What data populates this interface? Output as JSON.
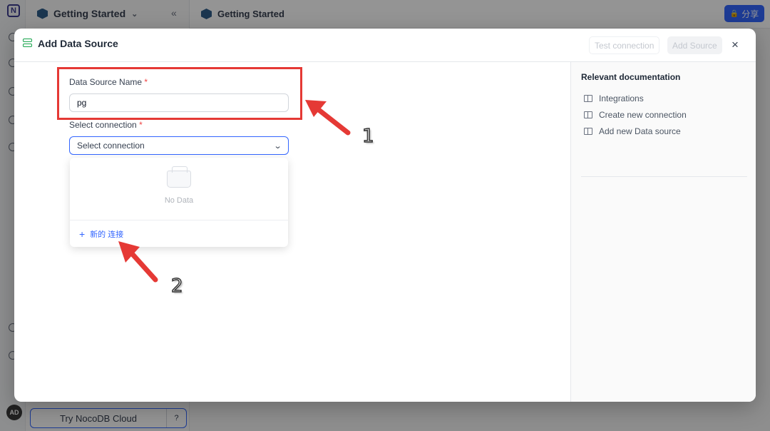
{
  "app": {
    "logo_letter": "N",
    "base_name": "Getting Started",
    "collapse_glyph": "«",
    "topbar_title": "Getting Started",
    "share_label": "分享",
    "cloud_button": "Try NocoDB Cloud",
    "help_glyph": "?",
    "avatar_initials": "AD"
  },
  "modal": {
    "title": "Add Data Source",
    "test_connection": "Test connection",
    "add_source": "Add Source",
    "close_glyph": "×",
    "form": {
      "name_label": "Data Source Name",
      "name_value": "pg",
      "connection_label": "Select connection",
      "required_mark": "*",
      "connection_placeholder": "Select connection",
      "empty_text": "No Data",
      "new_connection": "新的 连接"
    },
    "docs": {
      "title": "Relevant documentation",
      "links": [
        "Integrations",
        "Create new connection",
        "Add new Data source"
      ]
    }
  },
  "annotations": {
    "step1": "1",
    "step2": "2",
    "color": "#e53935"
  },
  "colors": {
    "accent": "#3366ff",
    "required": "#ef4444",
    "db_icon": "#16a34a"
  }
}
